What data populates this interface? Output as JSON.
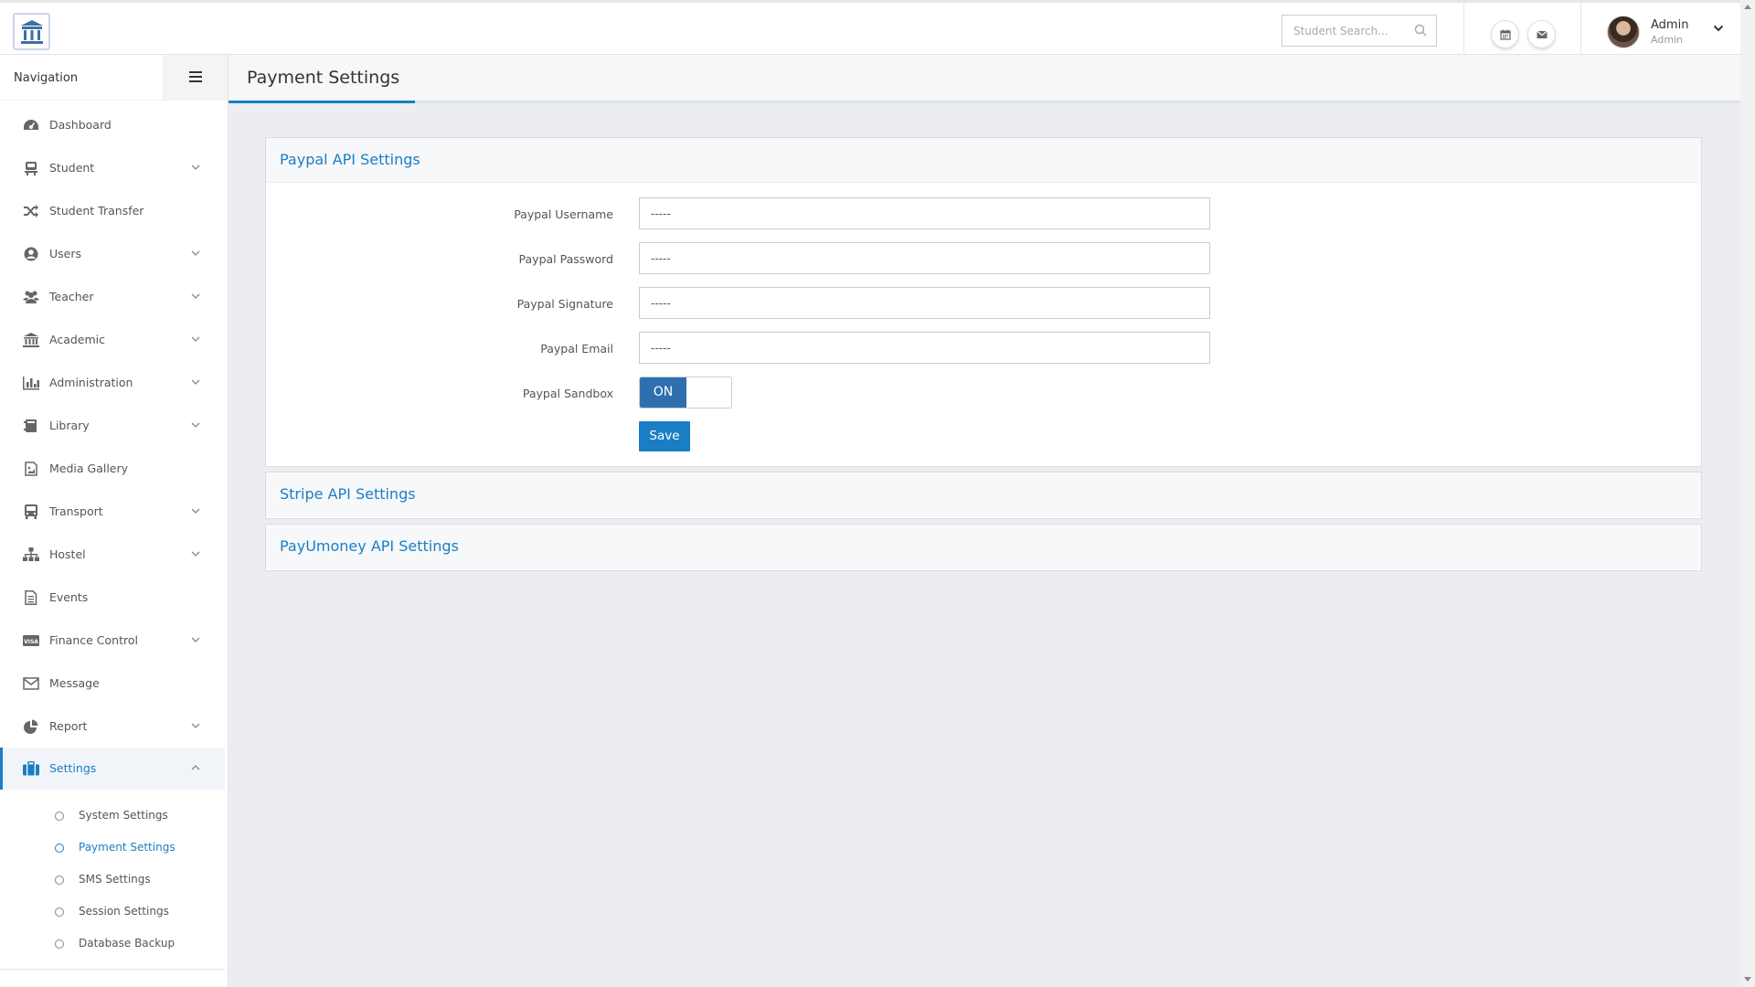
{
  "header": {
    "search_placeholder": "Student Search...",
    "user_name": "Admin",
    "user_role": "Admin"
  },
  "sidebar": {
    "title": "Navigation",
    "items": [
      {
        "label": "Dashboard",
        "icon": "dashboard-icon",
        "has_children": false
      },
      {
        "label": "Student",
        "icon": "student-icon",
        "has_children": true
      },
      {
        "label": "Student Transfer",
        "icon": "shuffle-icon",
        "has_children": false
      },
      {
        "label": "Users",
        "icon": "user-circle-icon",
        "has_children": true
      },
      {
        "label": "Teacher",
        "icon": "users-icon",
        "has_children": true
      },
      {
        "label": "Academic",
        "icon": "institution-icon",
        "has_children": true
      },
      {
        "label": "Administration",
        "icon": "bar-chart-icon",
        "has_children": true
      },
      {
        "label": "Library",
        "icon": "book-icon",
        "has_children": true
      },
      {
        "label": "Media Gallery",
        "icon": "image-icon",
        "has_children": false
      },
      {
        "label": "Transport",
        "icon": "bus-icon",
        "has_children": true
      },
      {
        "label": "Hostel",
        "icon": "sitemap-icon",
        "has_children": true
      },
      {
        "label": "Events",
        "icon": "document-icon",
        "has_children": false
      },
      {
        "label": "Finance Control",
        "icon": "visa-card-icon",
        "has_children": true
      },
      {
        "label": "Message",
        "icon": "envelope-icon",
        "has_children": false
      },
      {
        "label": "Report",
        "icon": "pie-chart-icon",
        "has_children": true
      },
      {
        "label": "Settings",
        "icon": "briefcase-icon",
        "has_children": true,
        "active": true
      }
    ],
    "settings_children": [
      {
        "label": "System Settings"
      },
      {
        "label": "Payment Settings",
        "active": true
      },
      {
        "label": "SMS Settings"
      },
      {
        "label": "Session Settings"
      },
      {
        "label": "Database Backup"
      }
    ]
  },
  "page": {
    "title": "Payment Settings"
  },
  "paypal": {
    "title": "Paypal API Settings",
    "fields": [
      {
        "label": "Paypal Username",
        "value": "-----"
      },
      {
        "label": "Paypal Password",
        "value": "-----"
      },
      {
        "label": "Paypal Signature",
        "value": "-----"
      },
      {
        "label": "Paypal Email",
        "value": "-----"
      }
    ],
    "sandbox_label": "Paypal Sandbox",
    "sandbox_state": "ON",
    "save_label": "Save"
  },
  "stripe": {
    "title": "Stripe API Settings"
  },
  "payumoney": {
    "title": "PayUmoney API Settings"
  },
  "colors": {
    "accent": "#1a7ec4",
    "toggle_on": "#2f6fb0",
    "background": "#ebedf1"
  }
}
